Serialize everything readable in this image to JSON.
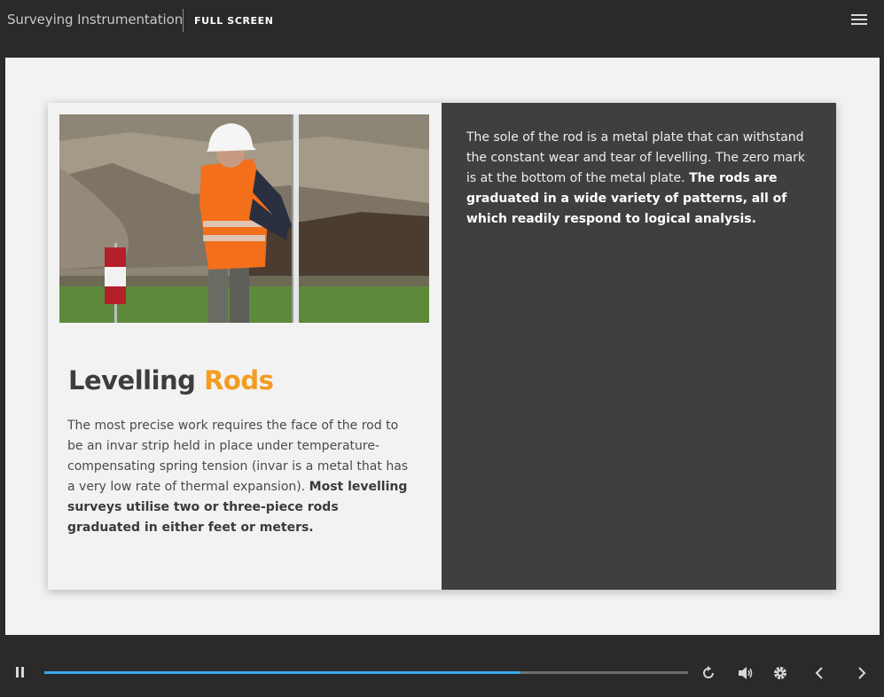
{
  "header": {
    "course_title": "Surveying Instrumentation",
    "fullscreen_label": "FULL SCREEN"
  },
  "slide": {
    "heading_main": "Levelling",
    "heading_accent": "Rods",
    "left_text": "The most precise work requires the face of the rod to be an invar strip held in place under temperature-compensating spring tension (invar is a metal that has a very low rate of thermal expansion).",
    "left_text_bold": "Most levelling surveys utilise two or three-piece rods graduated in either feet or meters.",
    "right_text": "The sole of the rod is a metal plate that can withstand the constant wear and tear of levelling. The zero mark is at the bottom of the metal plate.",
    "right_text_bold": "The rods are graduated in a wide variety of patterns, all of which readily respond to logical analysis."
  },
  "player": {
    "progress": 0.74,
    "icons": {
      "pause": "pause-icon",
      "replay": "replay-icon",
      "volume": "volume-icon",
      "settings": "gear-icon",
      "prev": "chevron-left-icon",
      "next": "chevron-right-icon",
      "menu": "hamburger-menu-icon"
    }
  },
  "colors": {
    "accent": "#f39c1f",
    "progress": "#3aa9e8",
    "dark_panel": "#3f3f3f",
    "chrome": "#2a2a2a"
  }
}
